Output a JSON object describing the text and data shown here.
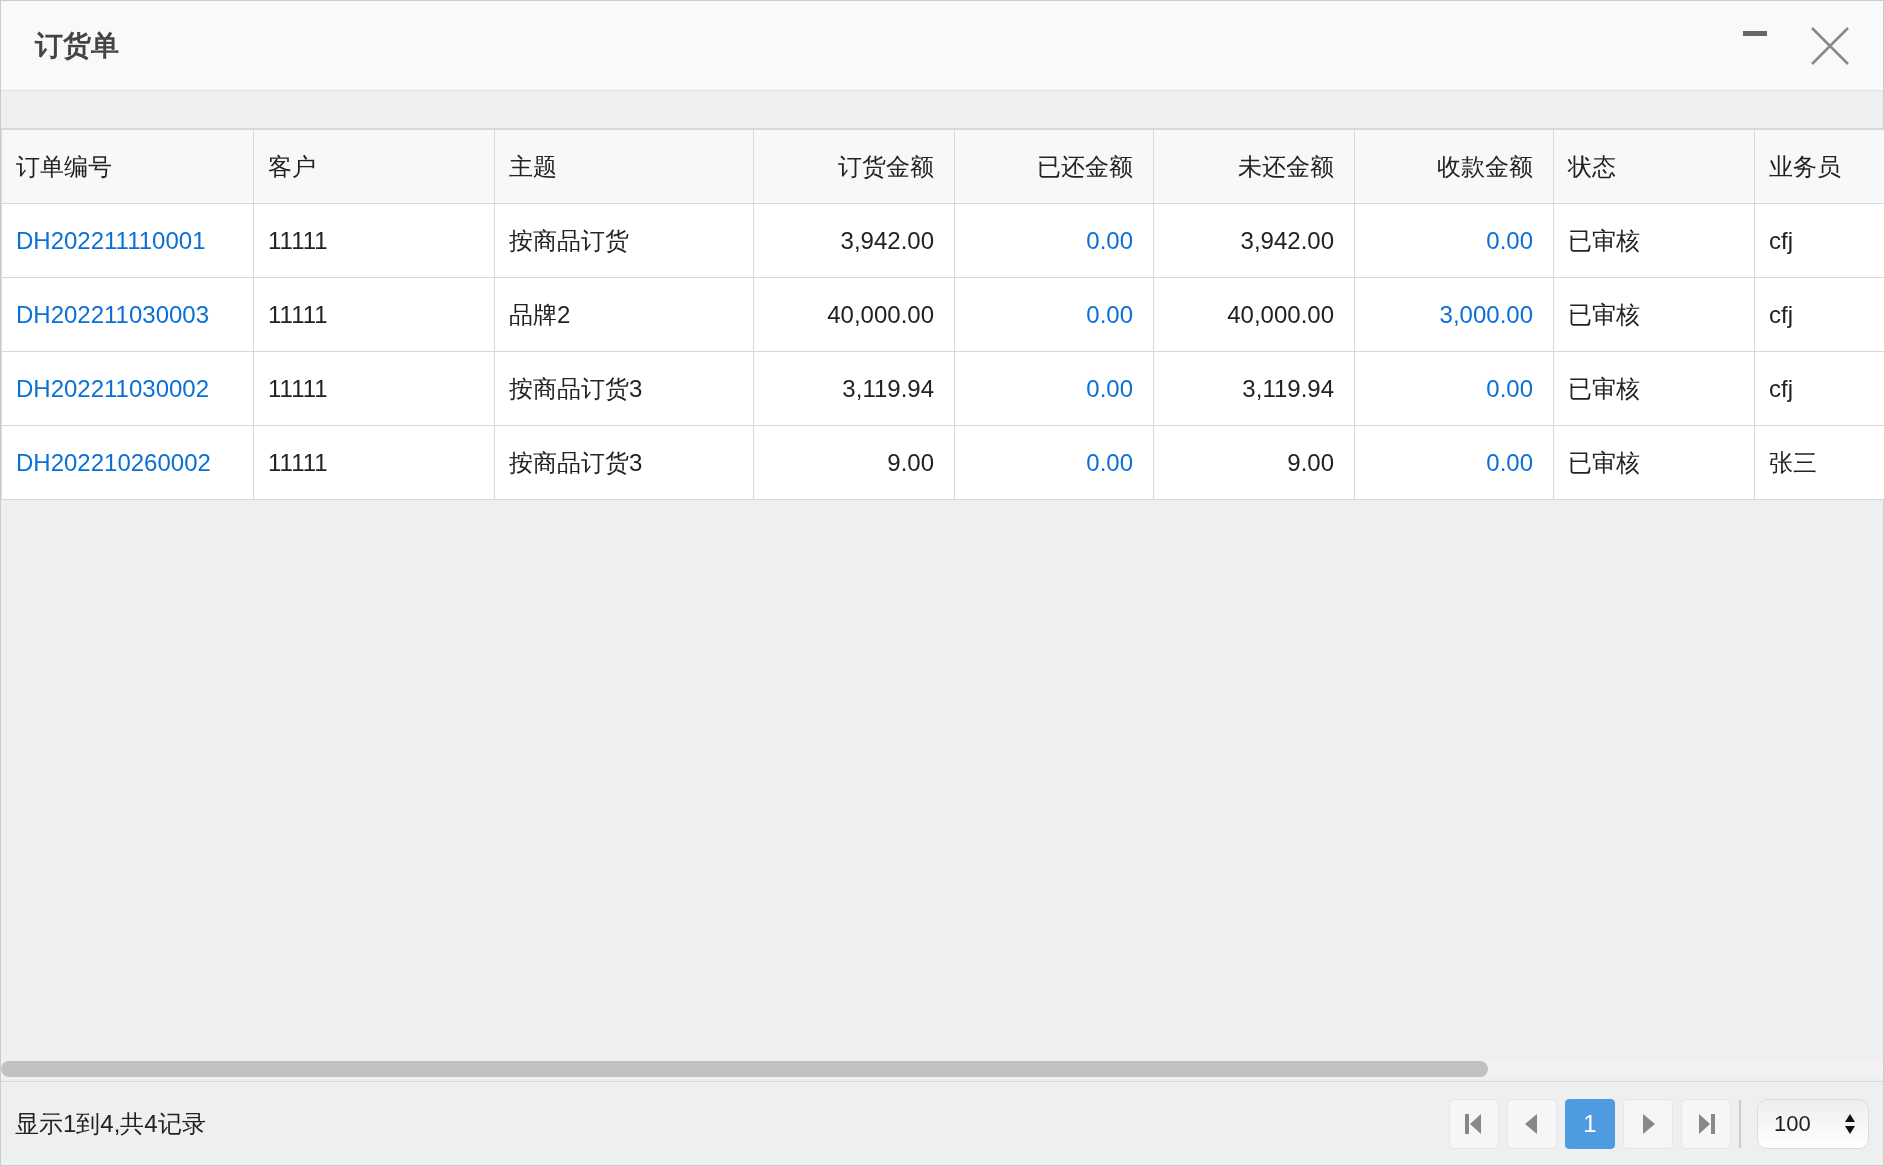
{
  "window": {
    "title": "订货单"
  },
  "table": {
    "columns": [
      {
        "label": "订单编号",
        "kind": "code"
      },
      {
        "label": "客户",
        "kind": "text"
      },
      {
        "label": "主题",
        "kind": "text"
      },
      {
        "label": "订货金额",
        "kind": "amount"
      },
      {
        "label": "已还金额",
        "kind": "payment"
      },
      {
        "label": "未还金额",
        "kind": "amount"
      },
      {
        "label": "收款金额",
        "kind": "payment"
      },
      {
        "label": "状态",
        "kind": "text"
      },
      {
        "label": "业务员",
        "kind": "text"
      }
    ],
    "rows": [
      [
        "DH202211110001",
        "11111",
        "按商品订货",
        "3,942.00",
        "0.00",
        "3,942.00",
        "0.00",
        "已审核",
        "cfj"
      ],
      [
        "DH202211030003",
        "11111",
        "品牌2",
        "40,000.00",
        "0.00",
        "40,000.00",
        "3,000.00",
        "已审核",
        "cfj"
      ],
      [
        "DH202211030002",
        "11111",
        "按商品订货3",
        "3,119.94",
        "0.00",
        "3,119.94",
        "0.00",
        "已审核",
        "cfj"
      ],
      [
        "DH202210260002",
        "11111",
        "按商品订货3",
        "9.00",
        "0.00",
        "9.00",
        "0.00",
        "已审核",
        "张三"
      ]
    ]
  },
  "footer": {
    "summary": "显示1到4,共4记录",
    "pager": [
      {
        "kind": "first"
      },
      {
        "kind": "prev"
      },
      {
        "kind": "page",
        "label": "1",
        "selected": true
      },
      {
        "kind": "next"
      },
      {
        "kind": "last"
      }
    ],
    "page_size": "100"
  }
}
